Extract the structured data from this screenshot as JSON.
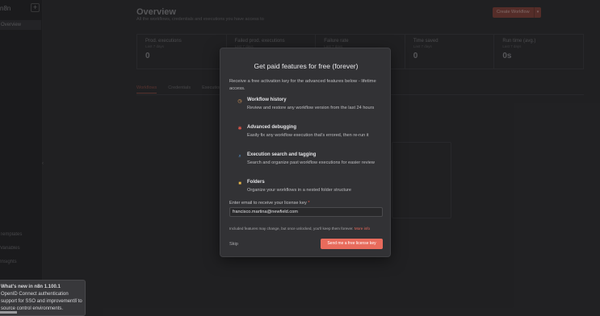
{
  "sidebar": {
    "logo": "n8n",
    "add_label": "+",
    "active_item": "Overview",
    "lower_items": [
      "Templates",
      "Variables",
      "Insights"
    ]
  },
  "main": {
    "title": "Overview",
    "subtitle": "All the workflows, credentials and executions you have access to",
    "create_label": "Create Workflow",
    "stats": [
      {
        "label": "Prod. executions",
        "sub": "Last 7 days",
        "value": "0"
      },
      {
        "label": "Failed prod. executions",
        "sub": "Last 7 days",
        "value": "0"
      },
      {
        "label": "Failure rate",
        "sub": "Last 7 days",
        "value": "0%"
      },
      {
        "label": "Time saved",
        "sub": "Last 7 days",
        "value": "0"
      },
      {
        "label": "Run time (avg.)",
        "sub": "Last 7 days",
        "value": "0s"
      }
    ],
    "tabs": [
      "Workflows",
      "Credentials",
      "Executions"
    ]
  },
  "modal": {
    "title": "Get paid features for free (forever)",
    "intro": "Receive a free activation key for the advanced features below - lifetime access.",
    "features": [
      {
        "icon": "history-icon",
        "glyph": "◷",
        "color": "#e8a25c",
        "title": "Workflow history",
        "desc": "Review and restore any workflow version from the last 24 hours"
      },
      {
        "icon": "bug-icon",
        "glyph": "✱",
        "color": "#e0574b",
        "title": "Advanced debugging",
        "desc": "Easily fix any workflow execution that's errored, then re-run it"
      },
      {
        "icon": "search-tag-icon",
        "glyph": "⌕",
        "color": "#5b9bd5",
        "title": "Execution search and tagging",
        "desc": "Search and organize past workflow executions for easier review"
      },
      {
        "icon": "folder-icon",
        "glyph": "■",
        "color": "#e8b84a",
        "title": "Folders",
        "desc": "Organize your workflows in a nested folder structure"
      }
    ],
    "email_label": "Enter email to receive your license key",
    "email_required": "*",
    "email_value": "francisco.martina@newfield.com",
    "note": "Included features may change, but once unlocked, you'll keep them forever.",
    "note_link": "More info",
    "skip_label": "Skip",
    "send_label": "Send me a free license key"
  },
  "toast": {
    "lines": [
      "What's new in n8n 1.100.1",
      "OpenID Connect authentication",
      "support for SSO and improvements to",
      "source control environments."
    ],
    "close": "×"
  },
  "colors": {
    "accent": "#e86b5c",
    "modal_bg": "#323235",
    "page_bg": "#2b2b2d"
  }
}
